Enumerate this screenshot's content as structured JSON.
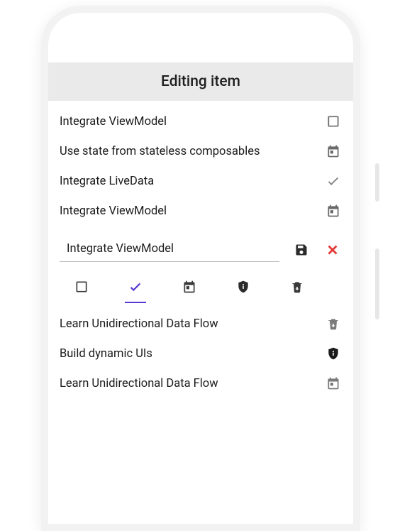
{
  "header": {
    "title": "Editing item"
  },
  "items_above": [
    {
      "label": "Integrate ViewModel",
      "icon": "square"
    },
    {
      "label": "Use state from stateless composables",
      "icon": "event"
    },
    {
      "label": "Integrate LiveData",
      "icon": "check"
    },
    {
      "label": "Integrate ViewModel",
      "icon": "event"
    }
  ],
  "edit": {
    "value": "Integrate ViewModel"
  },
  "toolbar": {
    "selected_index": 1
  },
  "items_below": [
    {
      "label": "Learn Unidirectional Data Flow",
      "icon": "trash"
    },
    {
      "label": "Build dynamic UIs",
      "icon": "shield"
    },
    {
      "label": "Learn Unidirectional Data Flow",
      "icon": "event"
    }
  ],
  "colors": {
    "accent": "#5a3ad6",
    "danger": "#e53935"
  }
}
